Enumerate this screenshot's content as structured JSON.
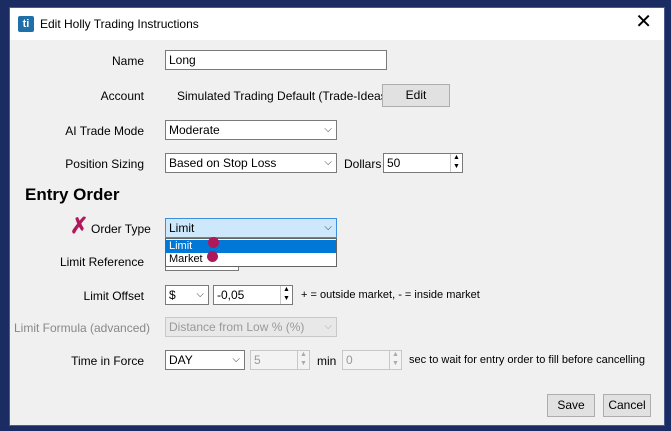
{
  "window": {
    "title": "Edit Holly Trading Instructions",
    "icon_text": "ti"
  },
  "fields": {
    "name": {
      "label": "Name",
      "value": "Long"
    },
    "account": {
      "label": "Account",
      "value": "Simulated Trading Default (Trade-Ideas)",
      "edit_label": "Edit"
    },
    "ai_trade_mode": {
      "label": "AI Trade Mode",
      "value": "Moderate"
    },
    "position_sizing": {
      "label": "Position Sizing",
      "value": "Based on Stop Loss",
      "dollars_label": "Dollars",
      "dollars_value": "50"
    }
  },
  "entry_order": {
    "heading": "Entry Order",
    "order_type": {
      "label": "Order Type",
      "value": "Limit",
      "options": [
        "Limit",
        "Market"
      ]
    },
    "limit_reference": {
      "label": "Limit Reference"
    },
    "limit_offset": {
      "label": "Limit Offset",
      "unit": "$",
      "value": "-0,05",
      "hint": "+ = outside market, - = inside market"
    },
    "limit_formula": {
      "label": "Limit Formula (advanced)",
      "value": "Distance from Low % (%)"
    },
    "time_in_force": {
      "label": "Time in Force",
      "value": "DAY",
      "minutes": "5",
      "min_label": "min",
      "seconds": "0",
      "sec_label": "sec to wait for entry order to fill before cancelling"
    }
  },
  "buttons": {
    "save": "Save",
    "cancel": "Cancel"
  },
  "annotation": {
    "marker_color": "#b0185c"
  }
}
